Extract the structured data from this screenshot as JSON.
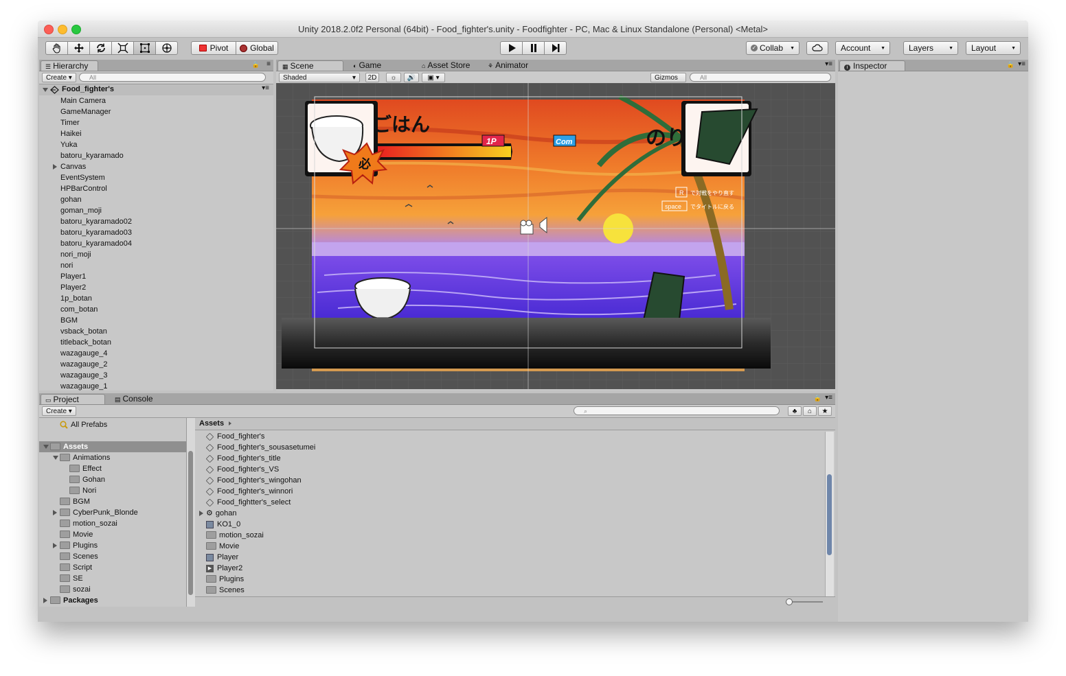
{
  "window": {
    "title": "Unity 2018.2.0f2 Personal (64bit) - Food_fighter's.unity - Foodfighter - PC, Mac & Linux Standalone (Personal) <Metal>"
  },
  "toolbar": {
    "pivot_label": "Pivot",
    "global_label": "Global",
    "collab_label": "Collab",
    "account_label": "Account",
    "layers_label": "Layers",
    "layout_label": "Layout"
  },
  "hierarchy": {
    "tab_label": "Hierarchy",
    "create_label": "Create",
    "search_placeholder": "All",
    "scene_name": "Food_fighter's",
    "items": [
      "Main Camera",
      "GameManager",
      "Timer",
      "Haikei",
      "Yuka",
      "batoru_kyaramado",
      "Canvas",
      "EventSystem",
      "HPBarControl",
      "gohan",
      "goman_moji",
      "batoru_kyaramado02",
      "batoru_kyaramado03",
      "batoru_kyaramado04",
      "nori_moji",
      "nori",
      "Player1",
      "Player2",
      "1p_botan",
      "com_botan",
      "BGM",
      "vsback_botan",
      "titleback_botan",
      "wazagauge_4",
      "wazagauge_2",
      "wazagauge_3",
      "wazagauge_1"
    ]
  },
  "scene": {
    "tabs": [
      "Scene",
      "Game",
      "Asset Store",
      "Animator"
    ],
    "shading_label": "Shaded",
    "mode_2d_label": "2D",
    "gizmos_label": "Gizmos",
    "search_placeholder": "All",
    "game": {
      "title_left": "ごはん",
      "title_right": "のり",
      "badge_1p": "1P",
      "badge_com": "Com",
      "special_mark": "必",
      "key_r": "R",
      "key_r_text": "で対戦をやり直す",
      "key_space": "space",
      "key_space_text": "でタイトルに戻る"
    }
  },
  "inspector": {
    "tab_label": "Inspector"
  },
  "project": {
    "tabs": [
      "Project",
      "Console"
    ],
    "create_label": "Create",
    "favorites": "All Prefabs",
    "tree": [
      {
        "label": "Assets",
        "bold": true,
        "selected": true
      },
      {
        "label": "Animations"
      },
      {
        "label": "Effect"
      },
      {
        "label": "Gohan"
      },
      {
        "label": "Nori"
      },
      {
        "label": "BGM"
      },
      {
        "label": "CyberPunk_Blonde"
      },
      {
        "label": "motion_sozai"
      },
      {
        "label": "Movie"
      },
      {
        "label": "Plugins"
      },
      {
        "label": "Scenes"
      },
      {
        "label": "Script"
      },
      {
        "label": "SE"
      },
      {
        "label": "sozai"
      },
      {
        "label": "Packages",
        "bold": true
      }
    ],
    "breadcrumb": "Assets",
    "assets": [
      "Food_fighter's",
      "Food_fighter's_sousasetumei",
      "Food_fighter's_title",
      "Food_fighter's_VS",
      "Food_fighter's_wingohan",
      "Food_fighter's_winnori",
      "Food_fightter's_select",
      "gohan",
      "KO1_0",
      "motion_sozai",
      "Movie",
      "Player",
      "Player2",
      "Plugins",
      "Scenes"
    ]
  },
  "colors": {
    "editor_bg": "#c2c2c2",
    "selection": "#8f8f8f",
    "scene_bg": "#525252"
  }
}
